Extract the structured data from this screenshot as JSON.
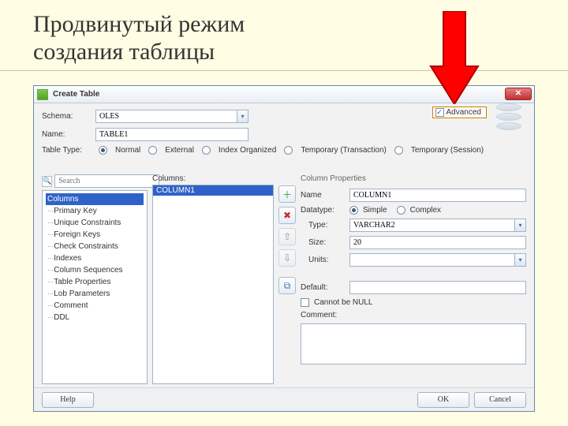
{
  "slide_title": "Продвинутый режим\nсоздания таблицы",
  "dialog": {
    "title": "Create Table",
    "close_glyph": "✕",
    "advanced_label": "Advanced",
    "form": {
      "schema_label": "Schema:",
      "schema_value": "OLES",
      "name_label": "Name:",
      "name_value": "TABLE1",
      "table_type_label": "Table Type:",
      "types": {
        "normal": "Normal",
        "external": "External",
        "index_org": "Index Organized",
        "temp_trans": "Temporary (Transaction)",
        "temp_sess": "Temporary (Session)"
      }
    },
    "search_placeholder": "Search",
    "tree": {
      "items": [
        "Columns",
        "Primary Key",
        "Unique Constraints",
        "Foreign Keys",
        "Check Constraints",
        "Indexes",
        "Column Sequences",
        "Table Properties",
        "Lob Parameters",
        "Comment",
        "DDL"
      ]
    },
    "columns_label": "Columns:",
    "columns": {
      "items": [
        "COLUMN1"
      ]
    },
    "toolbtn": {
      "add": "＋",
      "remove": "✖",
      "up": "⇧",
      "down": "⇩",
      "copy": "⧉"
    },
    "props": {
      "header": "Column Properties",
      "name_label": "Name",
      "name_value": "COLUMN1",
      "datatype_label": "Datatype:",
      "simple": "Simple",
      "complex": "Complex",
      "type_label": "Type:",
      "type_value": "VARCHAR2",
      "size_label": "Size:",
      "size_value": "20",
      "units_label": "Units:",
      "units_value": "",
      "default_label": "Default:",
      "default_value": "",
      "notnull_label": "Cannot be NULL",
      "comment_label": "Comment:"
    },
    "buttons": {
      "help": "Help",
      "ok": "OK",
      "cancel": "Cancel"
    }
  }
}
